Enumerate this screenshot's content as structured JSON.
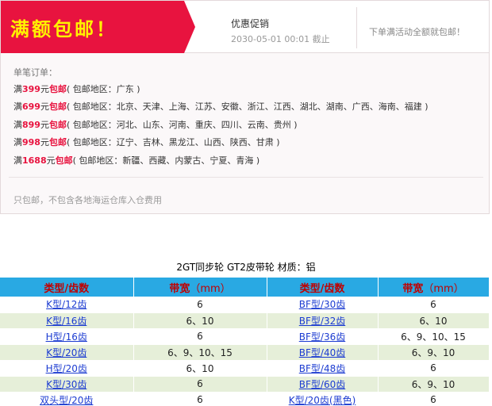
{
  "promo": {
    "ribbon_title": "满额包邮！",
    "name": "优惠促销",
    "time": "2030-05-01 00:01 截止",
    "note": "下单满活动全额就包邮！",
    "rules_title": "单笔订单：",
    "rules": [
      {
        "prefix": "满",
        "amount": "399",
        "unit": "元",
        "free": "包邮",
        "regions": "( 包邮地区：广东 )"
      },
      {
        "prefix": "满",
        "amount": "699",
        "unit": "元",
        "free": "包邮",
        "regions": "( 包邮地区：北京、天津、上海、江苏、安徽、浙江、江西、湖北、湖南、广西、海南、福建 )"
      },
      {
        "prefix": "满",
        "amount": "899",
        "unit": "元",
        "free": "包邮",
        "regions": "( 包邮地区：河北、山东、河南、重庆、四川、云南、贵州 )"
      },
      {
        "prefix": "满",
        "amount": "998",
        "unit": "元",
        "free": "包邮",
        "regions": "( 包邮地区：辽宁、吉林、黑龙江、山西、陕西、甘肃 )"
      },
      {
        "prefix": "满",
        "amount": "1688",
        "unit": "元",
        "free": "包邮",
        "regions": "( 包邮地区：新疆、西藏、内蒙古、宁夏、青海 )"
      }
    ],
    "footnote": "只包邮，不包含各地海运仓库入仓费用"
  },
  "table": {
    "title": "2GT同步轮  GT2皮带轮  材质：铝",
    "headers": {
      "type1": "类型/齿数",
      "width1": "带宽",
      "unit1": "（mm）",
      "type2": "类型/齿数",
      "width2": "带宽",
      "unit2": "（mm）"
    },
    "rows": [
      {
        "type1": "K型/12齿",
        "width1": "6",
        "type2": "BF型/30齿",
        "width2": "6"
      },
      {
        "type1": "K型/16齿",
        "width1": "6、10",
        "type2": "BF型/32齿",
        "width2": "6、10"
      },
      {
        "type1": "H型/16齿",
        "width1": "6",
        "type2": "BF型/36齿",
        "width2": "6、9、10、15"
      },
      {
        "type1": "K型/20齿",
        "width1": "6、9、10、15",
        "type2": "BF型/40齿",
        "width2": "6、9、10"
      },
      {
        "type1": "H型/20齿",
        "width1": "6、10",
        "type2": "BF型/48齿",
        "width2": "6"
      },
      {
        "type1": "K型/30齿",
        "width1": "6",
        "type2": "BF型/60齿",
        "width2": "6、9、10"
      },
      {
        "type1": "双头型/20齿",
        "width1": "6",
        "type2": "K型/20齿(黑色)",
        "width2": "6"
      }
    ]
  },
  "colors": {
    "accent_red": "#e8133f",
    "ribbon_text": "#fff200",
    "header_blue": "#29a9e3",
    "row_green": "#e6efd9",
    "link_blue": "#1b3bd1"
  }
}
